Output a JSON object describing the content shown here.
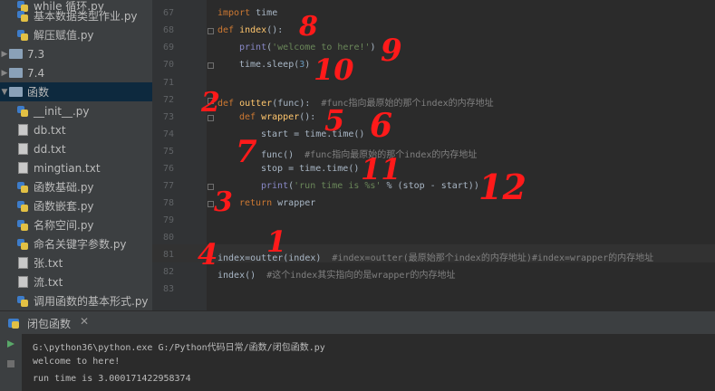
{
  "sidebar": {
    "items": [
      {
        "label": "while 循环.py",
        "icon": "py"
      },
      {
        "label": "基本数据类型作业.py",
        "icon": "py"
      },
      {
        "label": "解压赋值.py",
        "icon": "py"
      },
      {
        "label": "7.3",
        "icon": "folder"
      },
      {
        "label": "7.4",
        "icon": "folder"
      },
      {
        "label": "函数",
        "icon": "folder",
        "selected": true
      },
      {
        "label": "__init__.py",
        "icon": "py"
      },
      {
        "label": "db.txt",
        "icon": "txt"
      },
      {
        "label": "dd.txt",
        "icon": "txt"
      },
      {
        "label": "mingtian.txt",
        "icon": "txt"
      },
      {
        "label": "函数基础.py",
        "icon": "py"
      },
      {
        "label": "函数嵌套.py",
        "icon": "py"
      },
      {
        "label": "名称空间.py",
        "icon": "py"
      },
      {
        "label": "命名关键字参数.py",
        "icon": "py"
      },
      {
        "label": "张.txt",
        "icon": "txt"
      },
      {
        "label": "流.txt",
        "icon": "txt"
      },
      {
        "label": "调用函数的基本形式.py",
        "icon": "py"
      }
    ]
  },
  "editor": {
    "line_numbers": [
      "67",
      "68",
      "69",
      "70",
      "71",
      "72",
      "73",
      "74",
      "75",
      "76",
      "77",
      "78",
      "79",
      "80",
      "81",
      "82",
      "83"
    ],
    "lines": {
      "l67_kw": "import",
      "l67_rest": " time",
      "l68_kw": "def",
      "l68_fn": " index",
      "l68_rest": "():",
      "l69_bi": "print",
      "l69_p1": "(",
      "l69_str": "'welcome to here!'",
      "l69_p2": ")",
      "l70_a": "time.",
      "l70_b": "sleep",
      "l70_c": "(",
      "l70_num": "3",
      "l70_d": ")",
      "l72_kw": "def",
      "l72_fn": " outter",
      "l72_rest": "(func):",
      "l72_cm": "  #func指向最原始的那个index的内存地址",
      "l73_kw": "def",
      "l73_fn": " wrapper",
      "l73_rest": "():",
      "l74_a": "start = time.",
      "l74_b": "time",
      "l74_c": "()",
      "l75_a": "func()",
      "l75_cm": "  #func指向最原始的那个index的内存地址",
      "l76_a": "stop = time.",
      "l76_b": "time",
      "l76_c": "()",
      "l77_bi": "print",
      "l77_p1": "(",
      "l77_str": "'run time is %s'",
      "l77_rest": " % (stop - start))",
      "l78_kw": "return",
      "l78_rest": " wrapper",
      "l81_a": "index=outter(index)",
      "l81_cm": "  #index=outter(最原始那个index的内存地址)#index=wrapper的内存地址",
      "l82_a": "index()",
      "l82_cm": "  #这个index其实指向的是wrapper的内存地址"
    }
  },
  "run": {
    "tab_title": "闭包函数",
    "output": [
      "G:\\python36\\python.exe G:/Python代码日常/函数/闭包函数.py",
      "welcome to here!",
      "run time is 3.000171422958374"
    ]
  },
  "annotations": [
    "8",
    "9",
    "10",
    "2",
    "5",
    "6",
    "7",
    "11",
    "12",
    "3",
    "4",
    "1"
  ],
  "colors": {
    "annotation": "#ff1a1a",
    "keyword": "#cc7832",
    "function": "#ffc66d",
    "string": "#6a8759",
    "number": "#6897bb",
    "comment": "#808080"
  }
}
